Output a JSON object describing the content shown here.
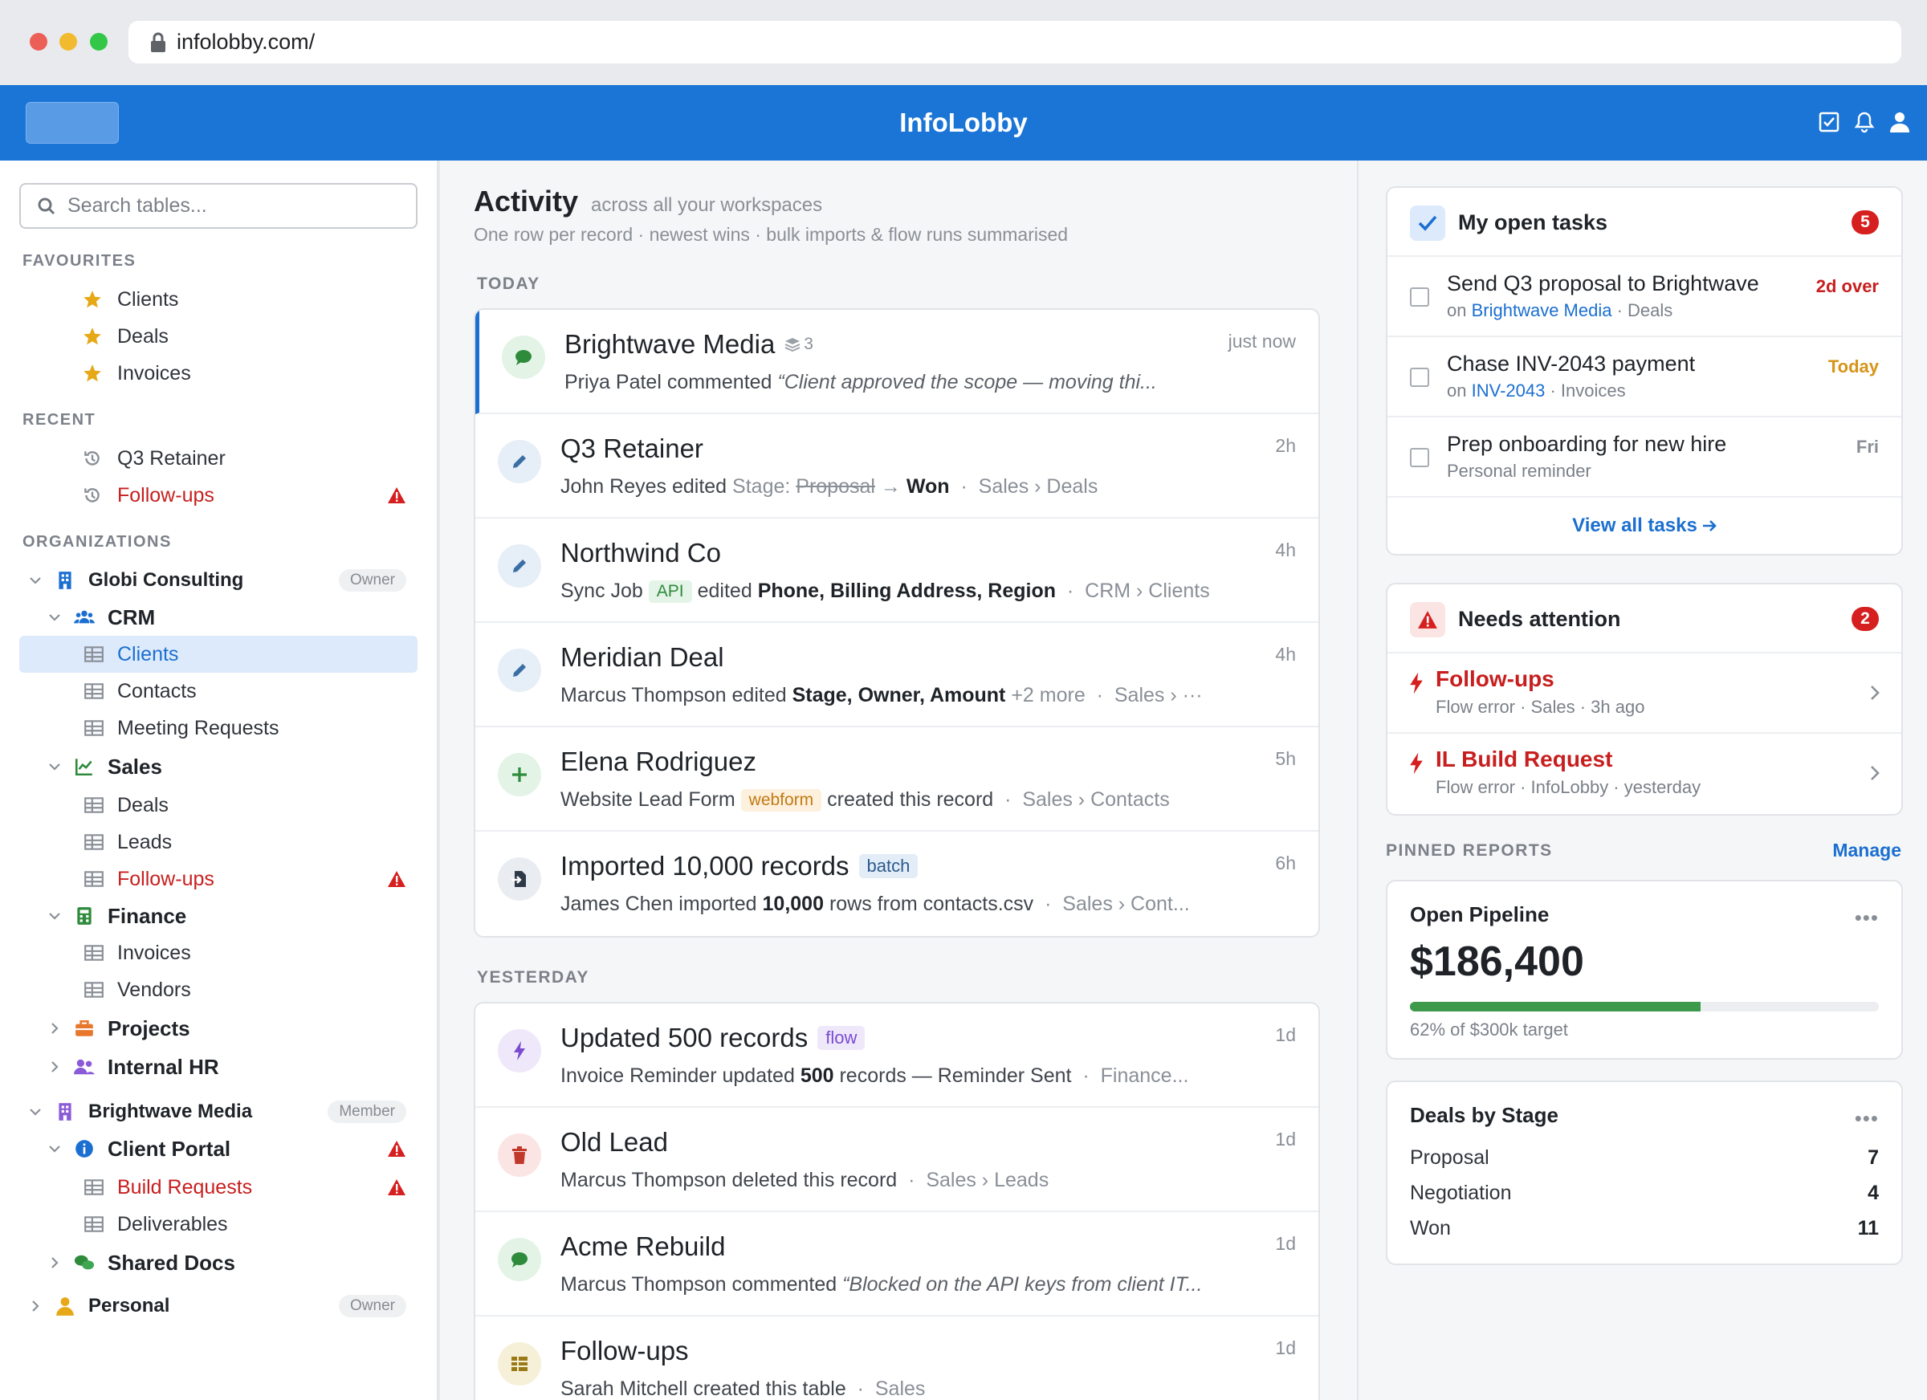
{
  "browser": {
    "url": "infolobby.com/"
  },
  "header": {
    "brand": "InfoLobby"
  },
  "sidebar": {
    "search_placeholder": "Search tables...",
    "favourites_label": "FAVOURITES",
    "favourites": [
      "Clients",
      "Deals",
      "Invoices"
    ],
    "recent_label": "RECENT",
    "recent": [
      "Q3 Retainer",
      "Follow-ups"
    ],
    "orgs_label": "ORGANIZATIONS",
    "org1": {
      "name": "Globi Consulting",
      "role": "Owner"
    },
    "crm": {
      "name": "CRM",
      "tables": [
        "Clients",
        "Contacts",
        "Meeting Requests"
      ]
    },
    "sales": {
      "name": "Sales",
      "tables": [
        "Deals",
        "Leads",
        "Follow-ups"
      ]
    },
    "finance": {
      "name": "Finance",
      "tables": [
        "Invoices",
        "Vendors"
      ]
    },
    "projects": "Projects",
    "hr": "Internal HR",
    "org2": {
      "name": "Brightwave Media",
      "role": "Member"
    },
    "portal": {
      "name": "Client Portal",
      "tables": [
        "Build Requests",
        "Deliverables"
      ]
    },
    "docs": "Shared Docs",
    "org3": {
      "name": "Personal",
      "role": "Owner"
    }
  },
  "feed": {
    "title": "Activity",
    "scope": "across all your workspaces",
    "subtitle": "One row per record · newest wins · bulk imports & flow runs summarised",
    "today_label": "TODAY",
    "yesterday_label": "YESTERDAY",
    "today": [
      {
        "title": "Brightwave Media",
        "stack": "3",
        "time": "just now",
        "actor": "Priya Patel commented",
        "quote": "“Client approved the scope — moving thi..."
      },
      {
        "title": "Q3 Retainer",
        "time": "2h",
        "actor": "John Reyes edited",
        "field": "Stage:",
        "from": "Proposal",
        "arrow": "→",
        "to": "Won",
        "path": "Sales › Deals"
      },
      {
        "title": "Northwind Co",
        "time": "4h",
        "actor": "Sync Job",
        "tag": "API",
        "verb": "edited",
        "fields": "Phone, Billing Address, Region",
        "path": "CRM › Clients"
      },
      {
        "title": "Meridian Deal",
        "time": "4h",
        "actor": "Marcus Thompson edited",
        "fields": "Stage, Owner, Amount",
        "more": "+2 more",
        "path": "Sales › ···"
      },
      {
        "title": "Elena Rodriguez",
        "time": "5h",
        "actor": "Website Lead Form",
        "tag": "webform",
        "verb": "created this record",
        "path": "Sales › Contacts"
      },
      {
        "title": "Imported 10,000 records",
        "tag": "batch",
        "time": "6h",
        "actor": "James Chen imported",
        "count": "10,000",
        "rest": "rows from contacts.csv",
        "path": "Sales › Cont..."
      }
    ],
    "yesterday": [
      {
        "title": "Updated 500 records",
        "tag": "flow",
        "time": "1d",
        "actor": "Invoice Reminder updated",
        "count": "500",
        "rest": "records — Reminder Sent",
        "path": "Finance..."
      },
      {
        "title": "Old Lead",
        "time": "1d",
        "actor": "Marcus Thompson deleted this record",
        "path": "Sales › Leads"
      },
      {
        "title": "Acme Rebuild",
        "time": "1d",
        "actor": "Marcus Thompson commented",
        "quote": "“Blocked on the API keys from client IT..."
      },
      {
        "title": "Follow-ups",
        "time": "1d",
        "actor": "Sarah Mitchell created this table",
        "path": "Sales"
      }
    ]
  },
  "tasks": {
    "title": "My open tasks",
    "count": "5",
    "items": [
      {
        "title": "Send Q3 proposal to Brightwave",
        "pre": "on",
        "link": "Brightwave Media",
        "post": "· Deals",
        "due": "2d over",
        "due_color": "#c81e1e"
      },
      {
        "title": "Chase INV-2043 payment",
        "pre": "on",
        "link": "INV-2043",
        "post": "· Invoices",
        "due": "Today",
        "due_color": "#d69418"
      },
      {
        "title": "Prep onboarding for new hire",
        "sub": "Personal reminder",
        "due": "Fri",
        "due_color": "#8a8f97"
      }
    ],
    "view_all": "View all tasks"
  },
  "attention": {
    "title": "Needs attention",
    "count": "2",
    "items": [
      {
        "title": "Follow-ups",
        "sub": "Flow error · Sales · 3h ago"
      },
      {
        "title": "IL Build Request",
        "sub": "Flow error · InfoLobby · yesterday"
      }
    ]
  },
  "reports": {
    "label": "PINNED REPORTS",
    "manage": "Manage",
    "pipeline": {
      "title": "Open Pipeline",
      "more": "•••",
      "value": "$186,400",
      "progress": 0.62,
      "caption": "62% of $300k target"
    },
    "stages": {
      "title": "Deals by Stage",
      "more": "•••",
      "rows": [
        {
          "label": "Proposal",
          "value": "7"
        },
        {
          "label": "Negotiation",
          "value": "4"
        },
        {
          "label": "Won",
          "value": "11"
        }
      ]
    }
  }
}
